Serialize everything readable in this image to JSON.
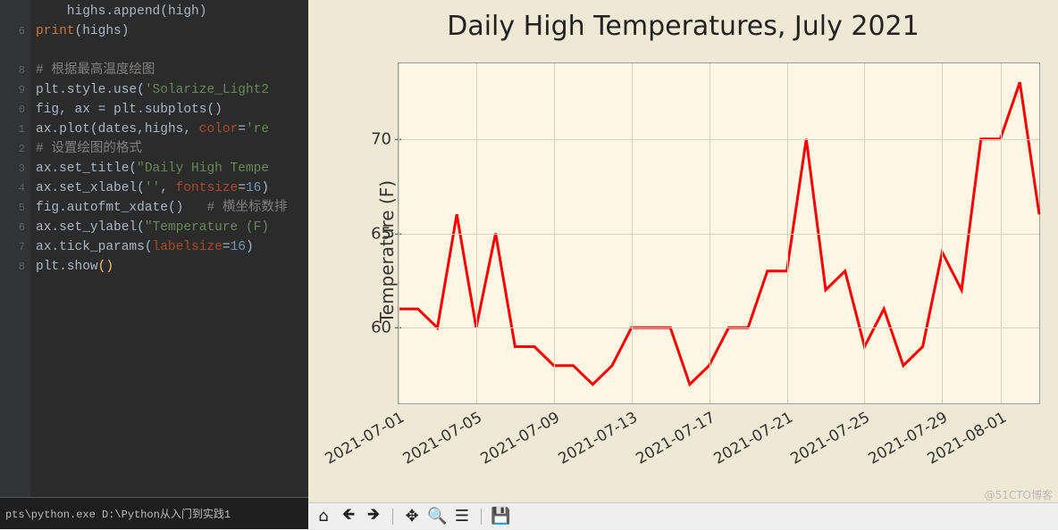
{
  "editor": {
    "line_numbers": [
      "",
      "6",
      "",
      "8",
      "9",
      "0",
      "1",
      "2",
      "3",
      "4",
      "5",
      "6",
      "7",
      "8"
    ],
    "code_tokens": [
      [
        [
          "",
          "    highs"
        ],
        [
          "fn",
          ".append"
        ],
        [
          "",
          "(high)"
        ]
      ],
      [
        [
          "kw",
          "print"
        ],
        [
          "",
          "(highs)"
        ]
      ],
      [
        [
          "",
          ""
        ]
      ],
      [
        [
          "cmt",
          "# 根据最高温度绘图"
        ]
      ],
      [
        [
          "",
          "plt"
        ],
        [
          "fn",
          ".style.use"
        ],
        [
          "",
          "("
        ],
        [
          "str",
          "'Solarize_Light2"
        ]
      ],
      [
        [
          "",
          "fig"
        ],
        [
          "",
          ", ax = plt"
        ],
        [
          "fn",
          ".subplots"
        ],
        [
          "",
          "()"
        ]
      ],
      [
        [
          "",
          "ax"
        ],
        [
          "fn",
          ".plot"
        ],
        [
          "",
          "(dates"
        ],
        [
          "",
          ",highs, "
        ],
        [
          "arg",
          "color"
        ],
        [
          "",
          "="
        ],
        [
          "str",
          "'re"
        ]
      ],
      [
        [
          "cmt",
          "# 设置绘图的格式"
        ]
      ],
      [
        [
          "",
          "ax"
        ],
        [
          "fn",
          ".set_title"
        ],
        [
          "",
          "("
        ],
        [
          "str",
          "\"Daily High Tempe"
        ]
      ],
      [
        [
          "",
          "ax"
        ],
        [
          "fn",
          ".set_xlabel"
        ],
        [
          "",
          "("
        ],
        [
          "str",
          "''"
        ],
        [
          "",
          ", "
        ],
        [
          "arg",
          "fontsize"
        ],
        [
          "",
          "="
        ],
        [
          "num",
          "16"
        ],
        [
          "",
          ")"
        ]
      ],
      [
        [
          "",
          "fig"
        ],
        [
          "fn",
          ".autofmt_xdate"
        ],
        [
          "",
          "()   "
        ],
        [
          "cmt",
          "# 横坐标数排"
        ]
      ],
      [
        [
          "",
          "ax"
        ],
        [
          "fn",
          ".set_ylabel"
        ],
        [
          "",
          "("
        ],
        [
          "str",
          "\"Temperature (F)"
        ]
      ],
      [
        [
          "",
          "ax"
        ],
        [
          "fn",
          ".tick_params"
        ],
        [
          "",
          "("
        ],
        [
          "arg",
          "labelsize"
        ],
        [
          "",
          "="
        ],
        [
          "num",
          "16"
        ],
        [
          "",
          ")"
        ]
      ],
      [
        [
          "",
          "plt"
        ],
        [
          "fn",
          ".show"
        ],
        [
          "par",
          "()"
        ]
      ]
    ],
    "terminal": "pts\\python.exe  D:\\Python从入门到实践1"
  },
  "chart_data": {
    "type": "line",
    "title": "Daily High Temperatures, July 2021",
    "ylabel": "Temperature (F)",
    "xlabel": "",
    "color": "red",
    "ylim": [
      56,
      74
    ],
    "yticks": [
      60,
      65,
      70
    ],
    "x": [
      "2021-07-01",
      "2021-07-02",
      "2021-07-03",
      "2021-07-04",
      "2021-07-05",
      "2021-07-06",
      "2021-07-07",
      "2021-07-08",
      "2021-07-09",
      "2021-07-10",
      "2021-07-11",
      "2021-07-12",
      "2021-07-13",
      "2021-07-14",
      "2021-07-15",
      "2021-07-16",
      "2021-07-17",
      "2021-07-18",
      "2021-07-19",
      "2021-07-20",
      "2021-07-21",
      "2021-07-22",
      "2021-07-23",
      "2021-07-24",
      "2021-07-25",
      "2021-07-26",
      "2021-07-27",
      "2021-07-28",
      "2021-07-29",
      "2021-07-30",
      "2021-07-31",
      "2021-08-01"
    ],
    "xticks": [
      "2021-07-01",
      "2021-07-05",
      "2021-07-09",
      "2021-07-13",
      "2021-07-17",
      "2021-07-21",
      "2021-07-25",
      "2021-07-29",
      "2021-08-01"
    ],
    "values": [
      61,
      61,
      60,
      66,
      60,
      65,
      59,
      59,
      58,
      58,
      57,
      58,
      60,
      60,
      60,
      57,
      58,
      60,
      60,
      63,
      63,
      70,
      62,
      63,
      59,
      61,
      58,
      59,
      64,
      62,
      70,
      70,
      73,
      66
    ]
  },
  "toolbar": {
    "items": [
      {
        "icon": "home-icon",
        "glyph": "⌂"
      },
      {
        "icon": "back-icon",
        "glyph": "🡸"
      },
      {
        "icon": "forward-icon",
        "glyph": "🡺"
      },
      {
        "sep": true
      },
      {
        "icon": "pan-icon",
        "glyph": "✥"
      },
      {
        "icon": "zoom-icon",
        "glyph": "🔍"
      },
      {
        "icon": "configure-icon",
        "glyph": "☰"
      },
      {
        "sep": true
      },
      {
        "icon": "save-icon",
        "glyph": "💾"
      }
    ]
  },
  "watermark": "@51CTO博客"
}
